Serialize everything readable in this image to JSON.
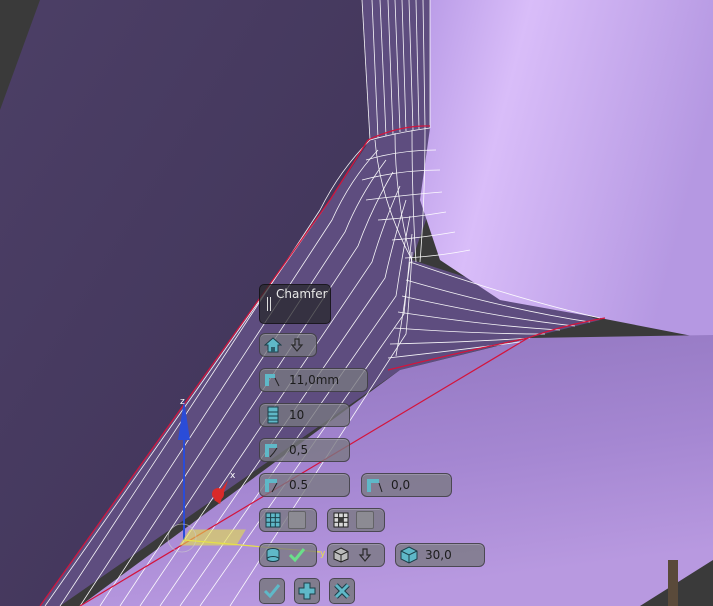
{
  "operation": {
    "title": "Chamfer",
    "icons": [
      "grip-icon"
    ]
  },
  "parameters": {
    "distance": "11,0mm",
    "segments": "10",
    "tension": "0,5",
    "depth": "0.5",
    "offset": "0,0",
    "angle": "30,0"
  },
  "controls": {
    "preset_icon": "house-preset-icon",
    "dropdown_icon": "arrow-down-icon"
  },
  "actions": [
    "ok-icon",
    "apply-continue-icon",
    "cancel-icon"
  ],
  "colors": {
    "background_dark": "#4a3d63",
    "surface_light": "#c8a8f0",
    "surface_mid": "#a78ad6",
    "wire": "#ffffff",
    "edge_red": "#d4143c",
    "gizmo_z": "#2a4cd8",
    "gizmo_x": "#d82a2a",
    "gizmo_plane": "#e6e04a"
  }
}
